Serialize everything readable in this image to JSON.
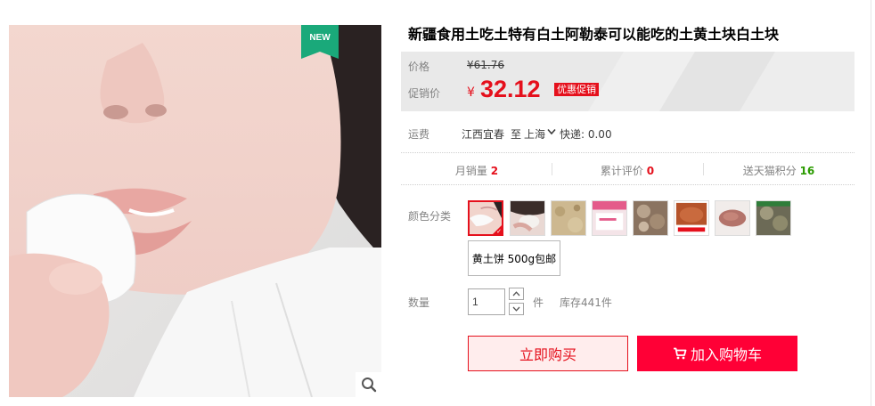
{
  "product": {
    "title": "新疆食用土吃土特有白土阿勒泰可以能吃的土黄土块白土块",
    "badge": "NEW"
  },
  "price": {
    "label": "价格",
    "original_currency": "¥",
    "original_value": "61.76",
    "promo_label": "促销价",
    "promo_currency": "¥",
    "promo_value": "32.12",
    "promo_tag": "优惠促销"
  },
  "shipping": {
    "label": "运费",
    "from": "江西宜春",
    "to_word": "至",
    "destination": "上海",
    "fee": "快递: 0.00"
  },
  "stats": {
    "monthly_sales_label": "月销量",
    "monthly_sales_value": "2",
    "reviews_label": "累计评价",
    "reviews_value": "0",
    "points_label": "送天猫积分",
    "points_value": "16"
  },
  "options": {
    "color_label": "颜色分类",
    "variant_label": "黄土饼 500g包邮"
  },
  "quantity": {
    "label": "数量",
    "value": "1",
    "unit": "件",
    "stock": "库存441件"
  },
  "actions": {
    "buy_now": "立即购买",
    "add_to_cart": "加入购物车"
  },
  "colors": {
    "accent_red": "#e5101c",
    "cart_red": "#ff0036",
    "badge_green": "#1aa97a",
    "points_green": "#2b9b00"
  }
}
